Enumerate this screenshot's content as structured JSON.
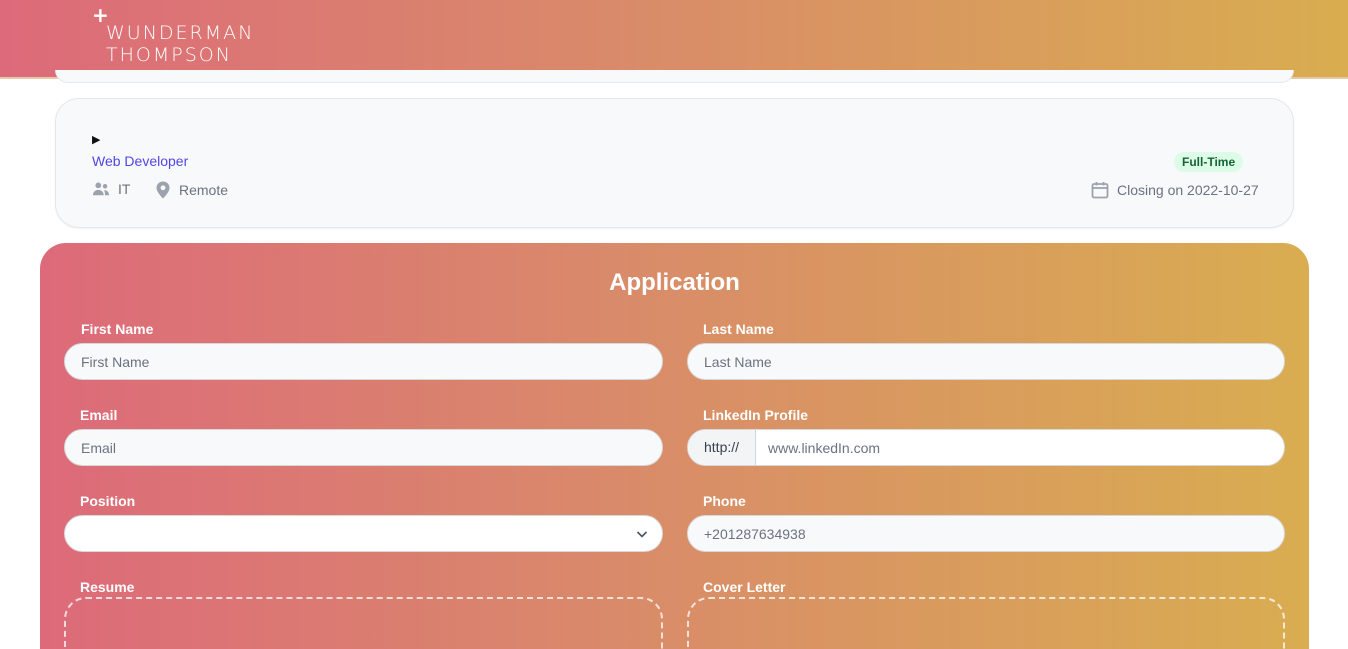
{
  "header": {
    "logo_line1": "WUNDERMAN",
    "logo_line2": "THOMPSON",
    "logo_plus": "+"
  },
  "job": {
    "toggle": "▶",
    "title": "Web Developer",
    "badge": "Full-Time",
    "department": "IT",
    "location": "Remote",
    "closing": "Closing on 2022-10-27",
    "department_icon": "users-icon",
    "location_icon": "map-pin-icon",
    "closing_icon": "calendar-icon"
  },
  "form": {
    "title": "Application",
    "first_name": {
      "label": "First Name",
      "placeholder": "First Name"
    },
    "last_name": {
      "label": "Last Name",
      "placeholder": "Last Name"
    },
    "email": {
      "label": "Email",
      "placeholder": "Email"
    },
    "linkedin": {
      "label": "LinkedIn Profile",
      "prefix": "http://",
      "placeholder": "www.linkedIn.com"
    },
    "position": {
      "label": "Position",
      "value": ""
    },
    "phone": {
      "label": "Phone",
      "placeholder": "+201287634938"
    },
    "resume": {
      "label": "Resume"
    },
    "cover_letter": {
      "label": "Cover Letter"
    }
  },
  "colors": {
    "gradient_start": "#dd6a7a",
    "gradient_end": "#d9ad50",
    "link": "#4f46e5",
    "badge_bg": "#dcfce7",
    "badge_text": "#166534"
  }
}
